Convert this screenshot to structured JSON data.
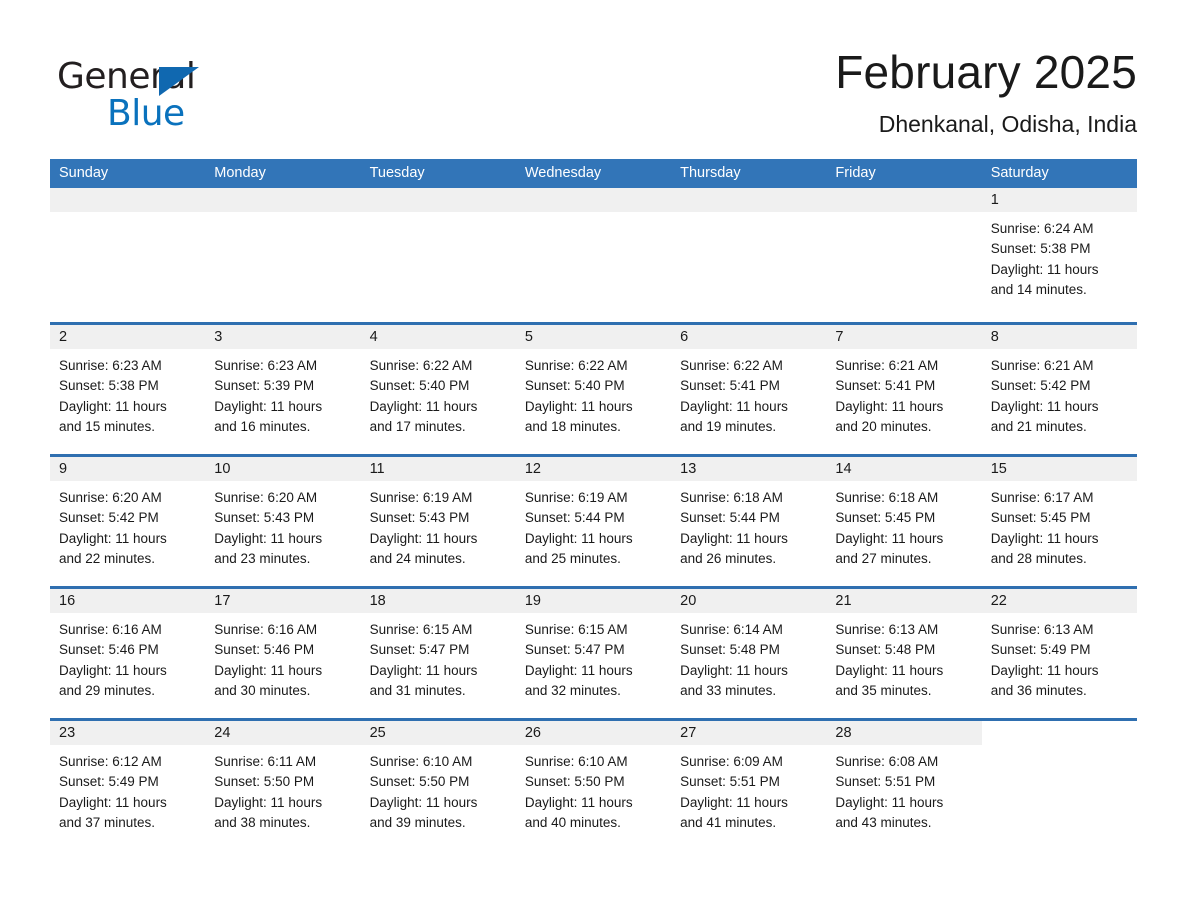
{
  "brand": {
    "name_part1": "General",
    "name_part2": "Blue",
    "triangle_color": "#1068b0",
    "blue_color": "#0a72bd"
  },
  "header": {
    "month_title": "February 2025",
    "location": "Dhenkanal, Odisha, India"
  },
  "theme": {
    "header_bg": "#3275b8",
    "row_border": "#2f6fb0",
    "day_band_bg": "#f0f0f0",
    "text": "#1a1a1a"
  },
  "weekdays": [
    "Sunday",
    "Monday",
    "Tuesday",
    "Wednesday",
    "Thursday",
    "Friday",
    "Saturday"
  ],
  "labels": {
    "sunrise_prefix": "Sunrise: ",
    "sunset_prefix": "Sunset: ",
    "daylight_prefix": "Daylight: "
  },
  "weeks": [
    [
      {
        "blank": true
      },
      {
        "blank": true
      },
      {
        "blank": true
      },
      {
        "blank": true
      },
      {
        "blank": true
      },
      {
        "blank": true
      },
      {
        "day": "1",
        "sunrise": "Sunrise: 6:24 AM",
        "sunset": "Sunset: 5:38 PM",
        "daylight1": "Daylight: 11 hours",
        "daylight2": "and 14 minutes."
      }
    ],
    [
      {
        "day": "2",
        "sunrise": "Sunrise: 6:23 AM",
        "sunset": "Sunset: 5:38 PM",
        "daylight1": "Daylight: 11 hours",
        "daylight2": "and 15 minutes."
      },
      {
        "day": "3",
        "sunrise": "Sunrise: 6:23 AM",
        "sunset": "Sunset: 5:39 PM",
        "daylight1": "Daylight: 11 hours",
        "daylight2": "and 16 minutes."
      },
      {
        "day": "4",
        "sunrise": "Sunrise: 6:22 AM",
        "sunset": "Sunset: 5:40 PM",
        "daylight1": "Daylight: 11 hours",
        "daylight2": "and 17 minutes."
      },
      {
        "day": "5",
        "sunrise": "Sunrise: 6:22 AM",
        "sunset": "Sunset: 5:40 PM",
        "daylight1": "Daylight: 11 hours",
        "daylight2": "and 18 minutes."
      },
      {
        "day": "6",
        "sunrise": "Sunrise: 6:22 AM",
        "sunset": "Sunset: 5:41 PM",
        "daylight1": "Daylight: 11 hours",
        "daylight2": "and 19 minutes."
      },
      {
        "day": "7",
        "sunrise": "Sunrise: 6:21 AM",
        "sunset": "Sunset: 5:41 PM",
        "daylight1": "Daylight: 11 hours",
        "daylight2": "and 20 minutes."
      },
      {
        "day": "8",
        "sunrise": "Sunrise: 6:21 AM",
        "sunset": "Sunset: 5:42 PM",
        "daylight1": "Daylight: 11 hours",
        "daylight2": "and 21 minutes."
      }
    ],
    [
      {
        "day": "9",
        "sunrise": "Sunrise: 6:20 AM",
        "sunset": "Sunset: 5:42 PM",
        "daylight1": "Daylight: 11 hours",
        "daylight2": "and 22 minutes."
      },
      {
        "day": "10",
        "sunrise": "Sunrise: 6:20 AM",
        "sunset": "Sunset: 5:43 PM",
        "daylight1": "Daylight: 11 hours",
        "daylight2": "and 23 minutes."
      },
      {
        "day": "11",
        "sunrise": "Sunrise: 6:19 AM",
        "sunset": "Sunset: 5:43 PM",
        "daylight1": "Daylight: 11 hours",
        "daylight2": "and 24 minutes."
      },
      {
        "day": "12",
        "sunrise": "Sunrise: 6:19 AM",
        "sunset": "Sunset: 5:44 PM",
        "daylight1": "Daylight: 11 hours",
        "daylight2": "and 25 minutes."
      },
      {
        "day": "13",
        "sunrise": "Sunrise: 6:18 AM",
        "sunset": "Sunset: 5:44 PM",
        "daylight1": "Daylight: 11 hours",
        "daylight2": "and 26 minutes."
      },
      {
        "day": "14",
        "sunrise": "Sunrise: 6:18 AM",
        "sunset": "Sunset: 5:45 PM",
        "daylight1": "Daylight: 11 hours",
        "daylight2": "and 27 minutes."
      },
      {
        "day": "15",
        "sunrise": "Sunrise: 6:17 AM",
        "sunset": "Sunset: 5:45 PM",
        "daylight1": "Daylight: 11 hours",
        "daylight2": "and 28 minutes."
      }
    ],
    [
      {
        "day": "16",
        "sunrise": "Sunrise: 6:16 AM",
        "sunset": "Sunset: 5:46 PM",
        "daylight1": "Daylight: 11 hours",
        "daylight2": "and 29 minutes."
      },
      {
        "day": "17",
        "sunrise": "Sunrise: 6:16 AM",
        "sunset": "Sunset: 5:46 PM",
        "daylight1": "Daylight: 11 hours",
        "daylight2": "and 30 minutes."
      },
      {
        "day": "18",
        "sunrise": "Sunrise: 6:15 AM",
        "sunset": "Sunset: 5:47 PM",
        "daylight1": "Daylight: 11 hours",
        "daylight2": "and 31 minutes."
      },
      {
        "day": "19",
        "sunrise": "Sunrise: 6:15 AM",
        "sunset": "Sunset: 5:47 PM",
        "daylight1": "Daylight: 11 hours",
        "daylight2": "and 32 minutes."
      },
      {
        "day": "20",
        "sunrise": "Sunrise: 6:14 AM",
        "sunset": "Sunset: 5:48 PM",
        "daylight1": "Daylight: 11 hours",
        "daylight2": "and 33 minutes."
      },
      {
        "day": "21",
        "sunrise": "Sunrise: 6:13 AM",
        "sunset": "Sunset: 5:48 PM",
        "daylight1": "Daylight: 11 hours",
        "daylight2": "and 35 minutes."
      },
      {
        "day": "22",
        "sunrise": "Sunrise: 6:13 AM",
        "sunset": "Sunset: 5:49 PM",
        "daylight1": "Daylight: 11 hours",
        "daylight2": "and 36 minutes."
      }
    ],
    [
      {
        "day": "23",
        "sunrise": "Sunrise: 6:12 AM",
        "sunset": "Sunset: 5:49 PM",
        "daylight1": "Daylight: 11 hours",
        "daylight2": "and 37 minutes."
      },
      {
        "day": "24",
        "sunrise": "Sunrise: 6:11 AM",
        "sunset": "Sunset: 5:50 PM",
        "daylight1": "Daylight: 11 hours",
        "daylight2": "and 38 minutes."
      },
      {
        "day": "25",
        "sunrise": "Sunrise: 6:10 AM",
        "sunset": "Sunset: 5:50 PM",
        "daylight1": "Daylight: 11 hours",
        "daylight2": "and 39 minutes."
      },
      {
        "day": "26",
        "sunrise": "Sunrise: 6:10 AM",
        "sunset": "Sunset: 5:50 PM",
        "daylight1": "Daylight: 11 hours",
        "daylight2": "and 40 minutes."
      },
      {
        "day": "27",
        "sunrise": "Sunrise: 6:09 AM",
        "sunset": "Sunset: 5:51 PM",
        "daylight1": "Daylight: 11 hours",
        "daylight2": "and 41 minutes."
      },
      {
        "day": "28",
        "sunrise": "Sunrise: 6:08 AM",
        "sunset": "Sunset: 5:51 PM",
        "daylight1": "Daylight: 11 hours",
        "daylight2": "and 43 minutes."
      },
      {
        "blank": true
      }
    ]
  ]
}
